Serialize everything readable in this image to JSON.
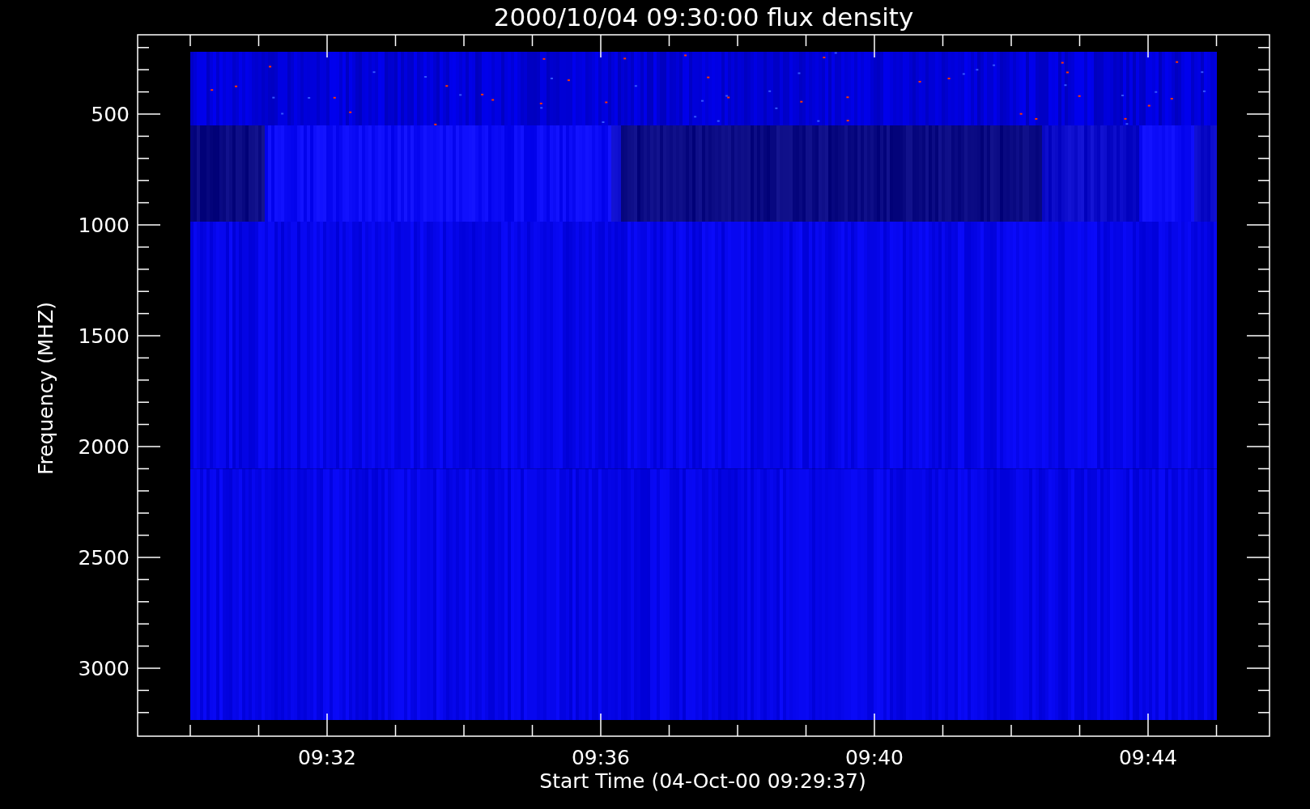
{
  "chart": {
    "title": "2000/10/04 09:30:00 flux density",
    "y_axis": {
      "label": "Frequency (MHZ)",
      "tick_labels": [
        "500",
        "1000",
        "1500",
        "2000",
        "2500",
        "3000"
      ]
    },
    "x_axis": {
      "label": "Start Time (04-Oct-00 09:29:37)",
      "tick_labels": [
        "09:32",
        "09:36",
        "09:40",
        "09:44"
      ]
    }
  }
}
